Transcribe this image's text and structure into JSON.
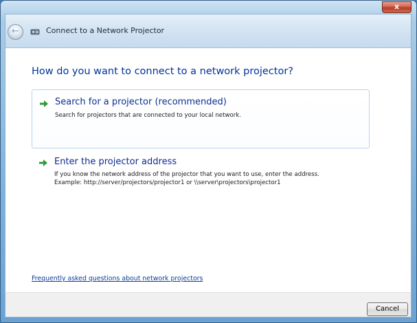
{
  "window": {
    "title": "Connect to a Network Projector",
    "close_label": "x"
  },
  "main": {
    "heading": "How do you want to connect to a network projector?",
    "options": [
      {
        "title": "Search for a projector (recommended)",
        "description": [
          "Search for projectors that are connected to your local network."
        ]
      },
      {
        "title": "Enter the projector address",
        "description": [
          "If you know the network address of the projector that you want to use, enter the address.",
          "Example: http://server/projectors/projector1 or \\\\server\\projectors\\projector1"
        ]
      }
    ],
    "faq_link": "Frequently asked questions about network projectors"
  },
  "footer": {
    "cancel_label": "Cancel"
  },
  "colors": {
    "heading": "#003399",
    "arrow": "#2e9a3a",
    "link": "#0a3d9c"
  }
}
